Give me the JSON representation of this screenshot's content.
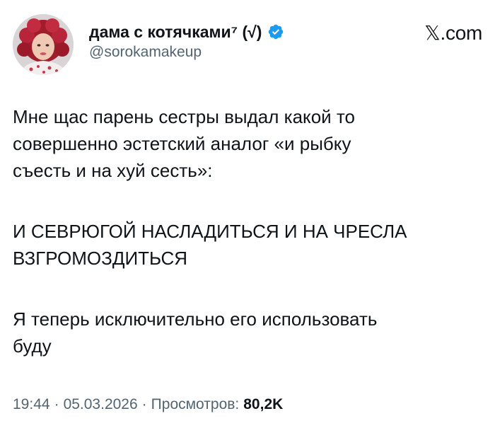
{
  "tweet": {
    "author": {
      "display_name": "дама с котячками⁷ (√)",
      "handle": "@sorokamakeup",
      "verified": true,
      "verified_color": "#1d9bf0"
    },
    "brand": {
      "domain": "𝕏.com",
      "icon": "x-logo-icon"
    },
    "paragraphs": [
      "Мне щас парень сестры выдал какой то\nсовершенно эстетский аналог «и рыбку\nсъесть и на хуй сесть»:",
      "И СЕВРЮГОЙ НАСЛАДИТЬСЯ И НА ЧРЕСЛА\nВЗГРОМОЗДИТЬСЯ",
      "Я теперь исключительно его использовать\nбуду"
    ],
    "meta": {
      "time": "19:44",
      "separator": "·",
      "date": "05.03.2026",
      "views_label": "Просмотров:",
      "views_count": "80,2K"
    }
  },
  "colors": {
    "text": "#0f1419",
    "secondary": "#536471",
    "background": "#ffffff"
  }
}
